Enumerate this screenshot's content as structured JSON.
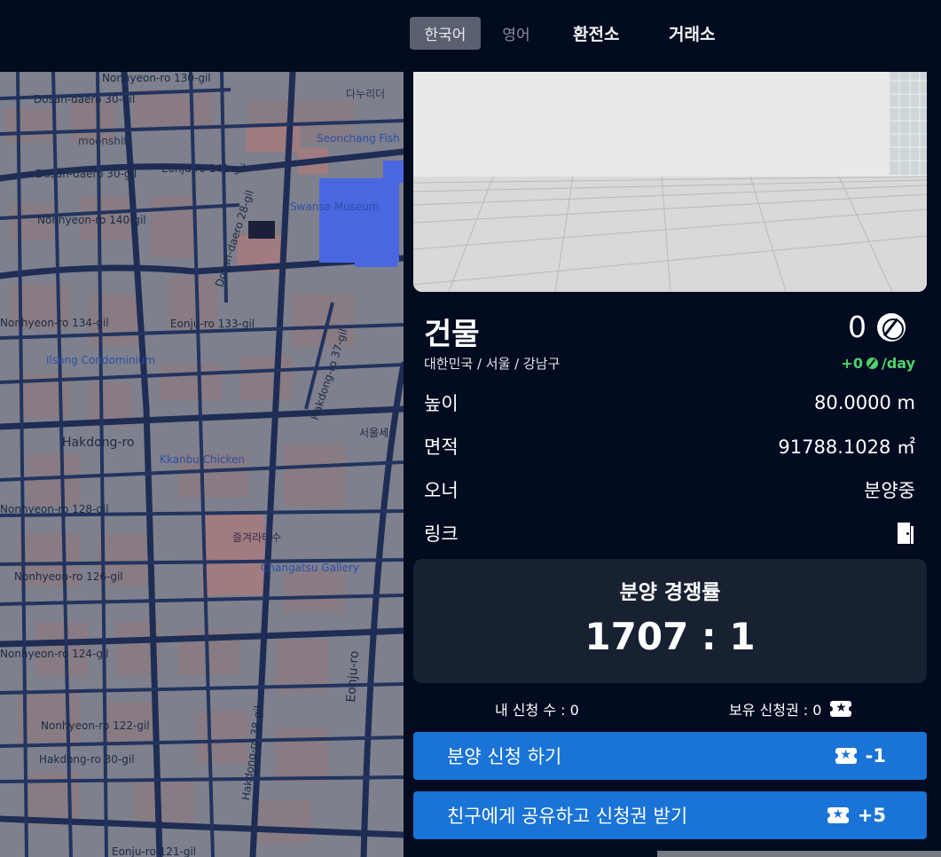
{
  "topbar": {
    "languages": [
      {
        "label": "한국어",
        "active": true
      },
      {
        "label": "영어",
        "active": false
      }
    ],
    "nav": [
      {
        "label": "환전소"
      },
      {
        "label": "거래소"
      }
    ]
  },
  "map": {
    "labels": [
      "Nonhyeon-ro 130-gil",
      "Dosan-daero 30-gil",
      "Dosan-daero 30-gil",
      "Eonju-ro 141-gil",
      "Nonhyeon-ro 140-gil",
      "Dosan-daero 28-gil",
      "Nonhyeon-ro 134-gil",
      "Eonju-ro 133-gil",
      "Hakdong-ro 37-gil",
      "Hakdong-ro",
      "Nonhyeon-ro 128-gil",
      "Nonhyeon-ro 126-gil",
      "Nonhyeon-ro 124-gil",
      "Nonhyeon-ro 122-gil",
      "Hakdong-ro 30-gil",
      "Hakdong-ro 38-gil",
      "Eonju-ro",
      "Eonju-ro 121-gil",
      "서울세"
    ],
    "pois": [
      "Seonchang Fish Restaurant",
      "Swanse Museum",
      "Ilsong Condominium",
      "Kkanbu Chicken",
      "Changatsu Gallery",
      "즐겨라터수",
      "moonshift",
      "다누리더"
    ]
  },
  "building": {
    "title": "건물",
    "location": "대한민국 / 서울 / 강남구",
    "balance": "0",
    "rate_prefix": "+0",
    "rate_suffix": "/day",
    "height_label": "높이",
    "height_value": "80.0000 m",
    "area_label": "면적",
    "area_value": "91788.1028 ㎡",
    "owner_label": "오너",
    "owner_value": "분양중",
    "link_label": "링크"
  },
  "competition": {
    "title": "분양 경쟁률",
    "ratio": "1707 : 1"
  },
  "counts": {
    "mine": "내 신청 수 : 0",
    "owned": "보유 신청권 : 0"
  },
  "buttons": {
    "apply_label": "분양 신청 하기",
    "apply_cost": "-1",
    "share_label": "친구에게 공유하고 신청권 받기",
    "share_reward": "+5"
  },
  "colors": {
    "background": "#020b1f",
    "accent_button": "#1a73d6",
    "income_green": "#4fd26a",
    "card": "#182132"
  }
}
